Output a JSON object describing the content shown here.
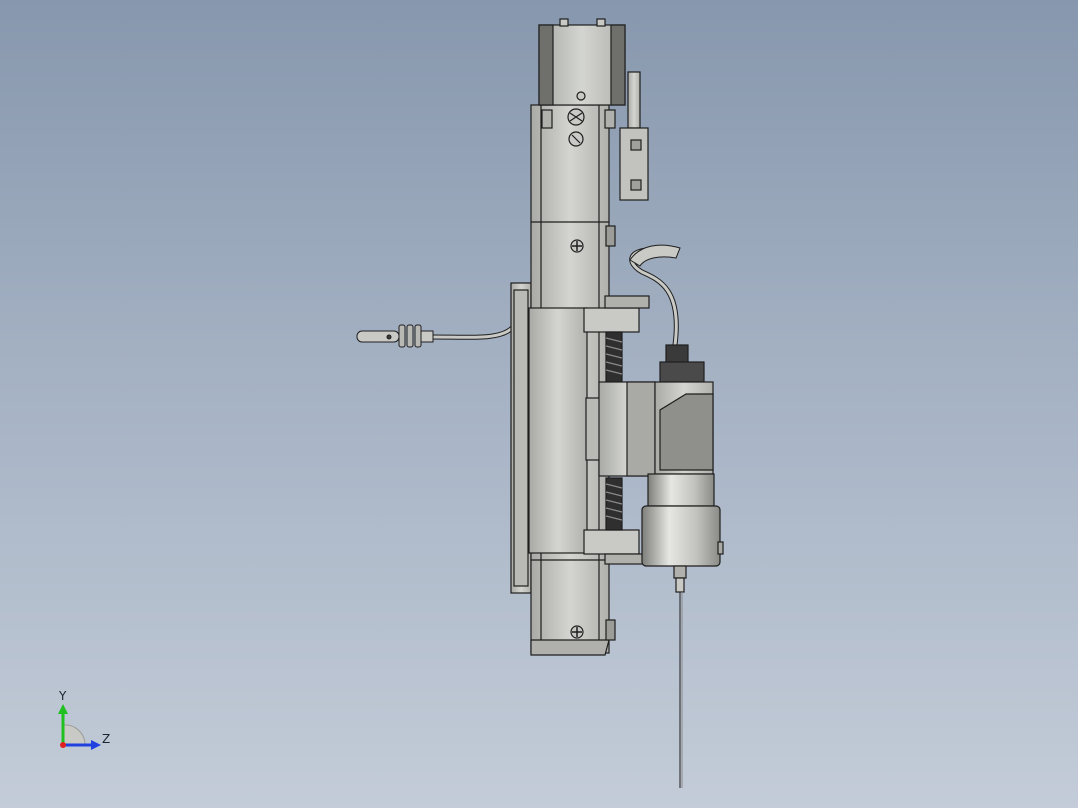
{
  "colors": {
    "background_top": "#8797ad",
    "background_bottom": "#c3ccd8",
    "body_metal": "#c9cac6",
    "body_shade": "#a9aaa6",
    "outline": "#1e1e1e",
    "dark_part": "#3a3a3a",
    "axis_x": "#e02020",
    "axis_y": "#20c020",
    "axis_z": "#2040e0"
  },
  "triad": {
    "y_label": "Y",
    "z_label": "Z"
  },
  "parts": {
    "motor_icon": "motor-housing-icon",
    "slide_icon": "linear-slide-icon",
    "carriage_icon": "carriage-plate-icon",
    "sensor_icon": "sensor-probe-icon",
    "dispenser_icon": "dispenser-valve-icon",
    "needle_icon": "needle-icon"
  }
}
